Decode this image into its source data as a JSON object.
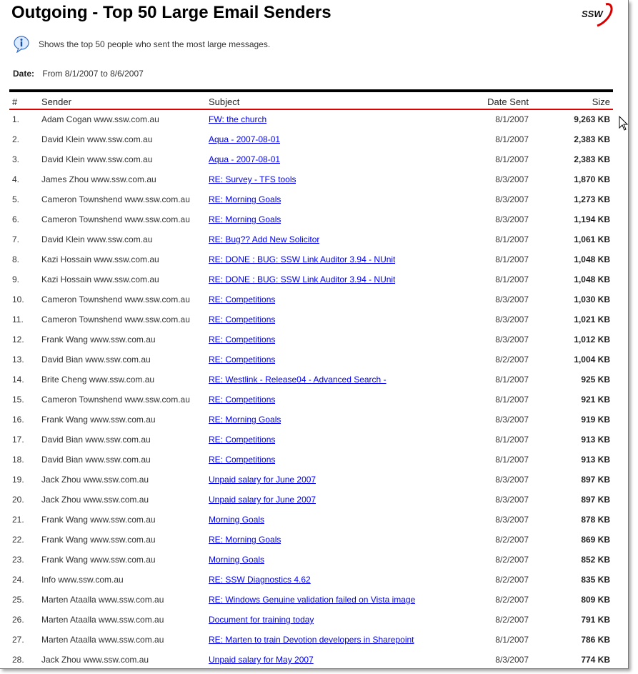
{
  "report": {
    "title": "Outgoing - Top 50 Large Email Senders",
    "logo_text": "SSW",
    "description": "Shows the top 50 people who sent the most large messages.",
    "date_label": "Date:",
    "date_range": "From 8/1/2007 to 8/6/2007"
  },
  "table": {
    "headers": {
      "num": "#",
      "sender": "Sender",
      "subject": "Subject",
      "date": "Date Sent",
      "size": "Size"
    },
    "rows": [
      {
        "num": "1.",
        "sender": "Adam Cogan www.ssw.com.au",
        "subject": "FW: the church",
        "date": "8/1/2007",
        "size": "9,263 KB"
      },
      {
        "num": "2.",
        "sender": "David Klein www.ssw.com.au",
        "subject": "Aqua - 2007-08-01",
        "date": "8/1/2007",
        "size": "2,383 KB"
      },
      {
        "num": "3.",
        "sender": "David Klein www.ssw.com.au",
        "subject": "Aqua - 2007-08-01",
        "date": "8/1/2007",
        "size": "2,383 KB"
      },
      {
        "num": "4.",
        "sender": "James Zhou www.ssw.com.au",
        "subject": "RE: Survey - TFS tools",
        "date": "8/3/2007",
        "size": "1,870 KB"
      },
      {
        "num": "5.",
        "sender": "Cameron Townshend www.ssw.com.au",
        "subject": "RE: Morning Goals",
        "date": "8/3/2007",
        "size": "1,273 KB"
      },
      {
        "num": "6.",
        "sender": "Cameron Townshend www.ssw.com.au",
        "subject": "RE: Morning Goals",
        "date": "8/3/2007",
        "size": "1,194 KB"
      },
      {
        "num": "7.",
        "sender": "David Klein www.ssw.com.au",
        "subject": "RE: Bug?? Add New Solicitor",
        "date": "8/1/2007",
        "size": "1,061 KB"
      },
      {
        "num": "8.",
        "sender": "Kazi Hossain www.ssw.com.au",
        "subject": "RE: DONE : BUG: SSW Link Auditor 3.94 - NUnit",
        "date": "8/1/2007",
        "size": "1,048 KB"
      },
      {
        "num": "9.",
        "sender": "Kazi Hossain www.ssw.com.au",
        "subject": "RE: DONE : BUG: SSW Link Auditor 3.94 - NUnit",
        "date": "8/1/2007",
        "size": "1,048 KB"
      },
      {
        "num": "10.",
        "sender": "Cameron Townshend www.ssw.com.au",
        "subject": "RE: Competitions",
        "date": "8/3/2007",
        "size": "1,030 KB"
      },
      {
        "num": "11.",
        "sender": "Cameron Townshend www.ssw.com.au",
        "subject": "RE: Competitions",
        "date": "8/3/2007",
        "size": "1,021 KB"
      },
      {
        "num": "12.",
        "sender": "Frank Wang www.ssw.com.au",
        "subject": "RE: Competitions",
        "date": "8/3/2007",
        "size": "1,012 KB"
      },
      {
        "num": "13.",
        "sender": "David Bian www.ssw.com.au",
        "subject": "RE: Competitions",
        "date": "8/2/2007",
        "size": "1,004 KB"
      },
      {
        "num": "14.",
        "sender": "Brite Cheng www.ssw.com.au",
        "subject": "RE: Westlink - Release04 - Advanced Search -",
        "date": "8/1/2007",
        "size": "925 KB"
      },
      {
        "num": "15.",
        "sender": "Cameron Townshend www.ssw.com.au",
        "subject": "RE: Competitions",
        "date": "8/1/2007",
        "size": "921 KB"
      },
      {
        "num": "16.",
        "sender": "Frank Wang www.ssw.com.au",
        "subject": "RE: Morning Goals",
        "date": "8/3/2007",
        "size": "919 KB"
      },
      {
        "num": "17.",
        "sender": "David Bian www.ssw.com.au",
        "subject": "RE: Competitions",
        "date": "8/1/2007",
        "size": "913 KB"
      },
      {
        "num": "18.",
        "sender": "David Bian www.ssw.com.au",
        "subject": "RE: Competitions",
        "date": "8/1/2007",
        "size": "913 KB"
      },
      {
        "num": "19.",
        "sender": "Jack Zhou www.ssw.com.au",
        "subject": "Unpaid salary for June 2007",
        "date": "8/3/2007",
        "size": "897 KB"
      },
      {
        "num": "20.",
        "sender": "Jack Zhou www.ssw.com.au",
        "subject": "Unpaid salary for June 2007",
        "date": "8/3/2007",
        "size": "897 KB"
      },
      {
        "num": "21.",
        "sender": "Frank Wang www.ssw.com.au",
        "subject": "Morning Goals",
        "date": "8/3/2007",
        "size": "878 KB"
      },
      {
        "num": "22.",
        "sender": "Frank Wang www.ssw.com.au",
        "subject": "RE: Morning Goals",
        "date": "8/2/2007",
        "size": "869 KB"
      },
      {
        "num": "23.",
        "sender": "Frank Wang www.ssw.com.au",
        "subject": "Morning Goals",
        "date": "8/2/2007",
        "size": "852 KB"
      },
      {
        "num": "24.",
        "sender": "Info www.ssw.com.au",
        "subject": "RE: SSW Diagnostics 4.62",
        "date": "8/2/2007",
        "size": "835 KB"
      },
      {
        "num": "25.",
        "sender": "Marten Ataalla www.ssw.com.au",
        "subject": "RE: Windows Genuine validation failed on Vista image",
        "date": "8/2/2007",
        "size": "809 KB"
      },
      {
        "num": "26.",
        "sender": "Marten Ataalla www.ssw.com.au",
        "subject": "Document for training today",
        "date": "8/2/2007",
        "size": "791 KB"
      },
      {
        "num": "27.",
        "sender": "Marten Ataalla www.ssw.com.au",
        "subject": "RE: Marten to train Devotion developers in Sharepoint",
        "date": "8/1/2007",
        "size": "786 KB"
      },
      {
        "num": "28.",
        "sender": "Jack Zhou www.ssw.com.au",
        "subject": "Unpaid salary for May 2007",
        "date": "8/3/2007",
        "size": "774 KB"
      }
    ]
  },
  "icons": {
    "info": "info-icon",
    "logo": "ssw-logo",
    "cursor": "mouse-cursor-icon"
  },
  "colors": {
    "link": "#0000ee",
    "header_rule": "#000000",
    "accent_rule": "#e00000"
  }
}
